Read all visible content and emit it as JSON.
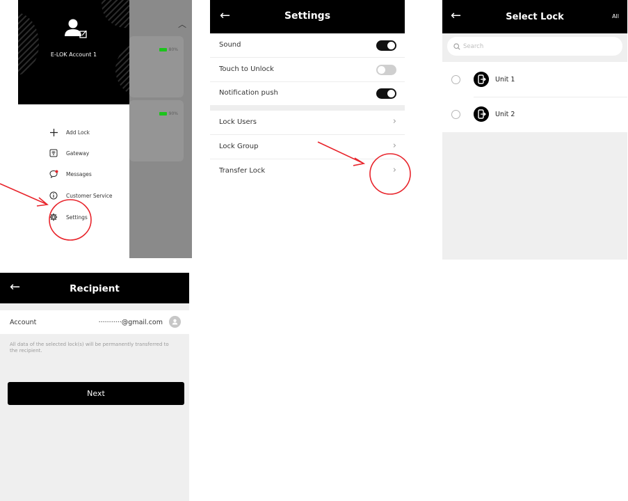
{
  "menu": {
    "account_name": "E-LOK Account 1",
    "lock_cards": [
      {
        "battery": "80%",
        "battery_color": "#1cc41c"
      },
      {
        "battery": "90%",
        "battery_color": "#1cc41c"
      }
    ],
    "items": [
      {
        "label": "Add Lock",
        "icon": "plus-icon"
      },
      {
        "label": "Gateway",
        "icon": "gateway-icon"
      },
      {
        "label": "Messages",
        "icon": "messages-icon"
      },
      {
        "label": "Customer Service",
        "icon": "info-icon"
      },
      {
        "label": "Settings",
        "icon": "gear-icon"
      }
    ]
  },
  "settings": {
    "title": "Settings",
    "toggles": [
      {
        "label": "Sound",
        "on": true
      },
      {
        "label": "Touch to Unlock",
        "on": false
      },
      {
        "label": "Notification push",
        "on": true
      }
    ],
    "links": [
      {
        "label": "Lock Users"
      },
      {
        "label": "Lock Group"
      },
      {
        "label": "Transfer Lock"
      }
    ]
  },
  "select_lock": {
    "title": "Select Lock",
    "all_label": "All",
    "search_placeholder": "Search",
    "locks": [
      {
        "name": "Unit 1"
      },
      {
        "name": "Unit 2"
      }
    ]
  },
  "recipient": {
    "title": "Recipient",
    "account_label": "Account",
    "account_value": "···········@gmail.com",
    "note": "All data of the selected lock(s) will be permanently transferred to the recipient.",
    "next_label": "Next"
  },
  "colors": {
    "header_bg": "#000000",
    "annotation_red": "#e8232a",
    "battery_green": "#1cc41c"
  }
}
